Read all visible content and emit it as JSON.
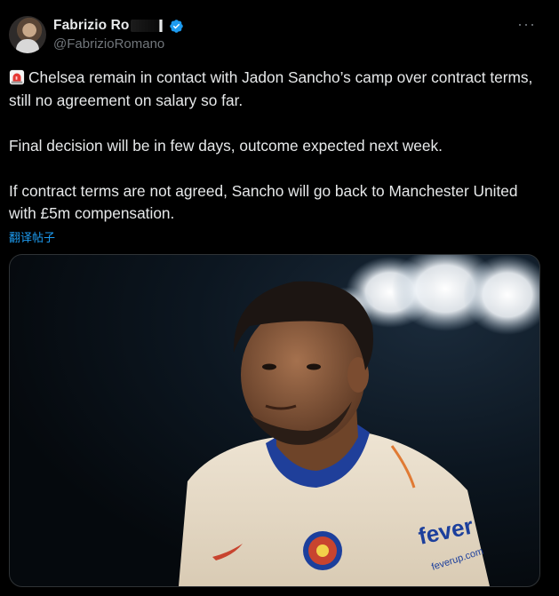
{
  "author": {
    "display_name": "Fabrizio Ro",
    "handle": "@FabrizioRomano",
    "verified": true
  },
  "more_icon": "more-horizontal-icon",
  "tweet": {
    "paragraphs": [
      "Chelsea remain in contact with Jadon Sancho’s camp over contract terms, still no agreement on salary so far.",
      "Final decision will be in few days, outcome expected next week.",
      "If contract terms are not agreed, Sancho will go back to Manchester United with £5m compensation."
    ],
    "lead_emoji": "siren-icon",
    "translate_label": "翻译帖子"
  },
  "media": {
    "kit_sponsor_main": "fever",
    "kit_sponsor_url": "feverup.com"
  },
  "colors": {
    "background": "#000000",
    "text": "#e7e9ea",
    "muted": "#71767b",
    "accent": "#1d9bf0"
  }
}
